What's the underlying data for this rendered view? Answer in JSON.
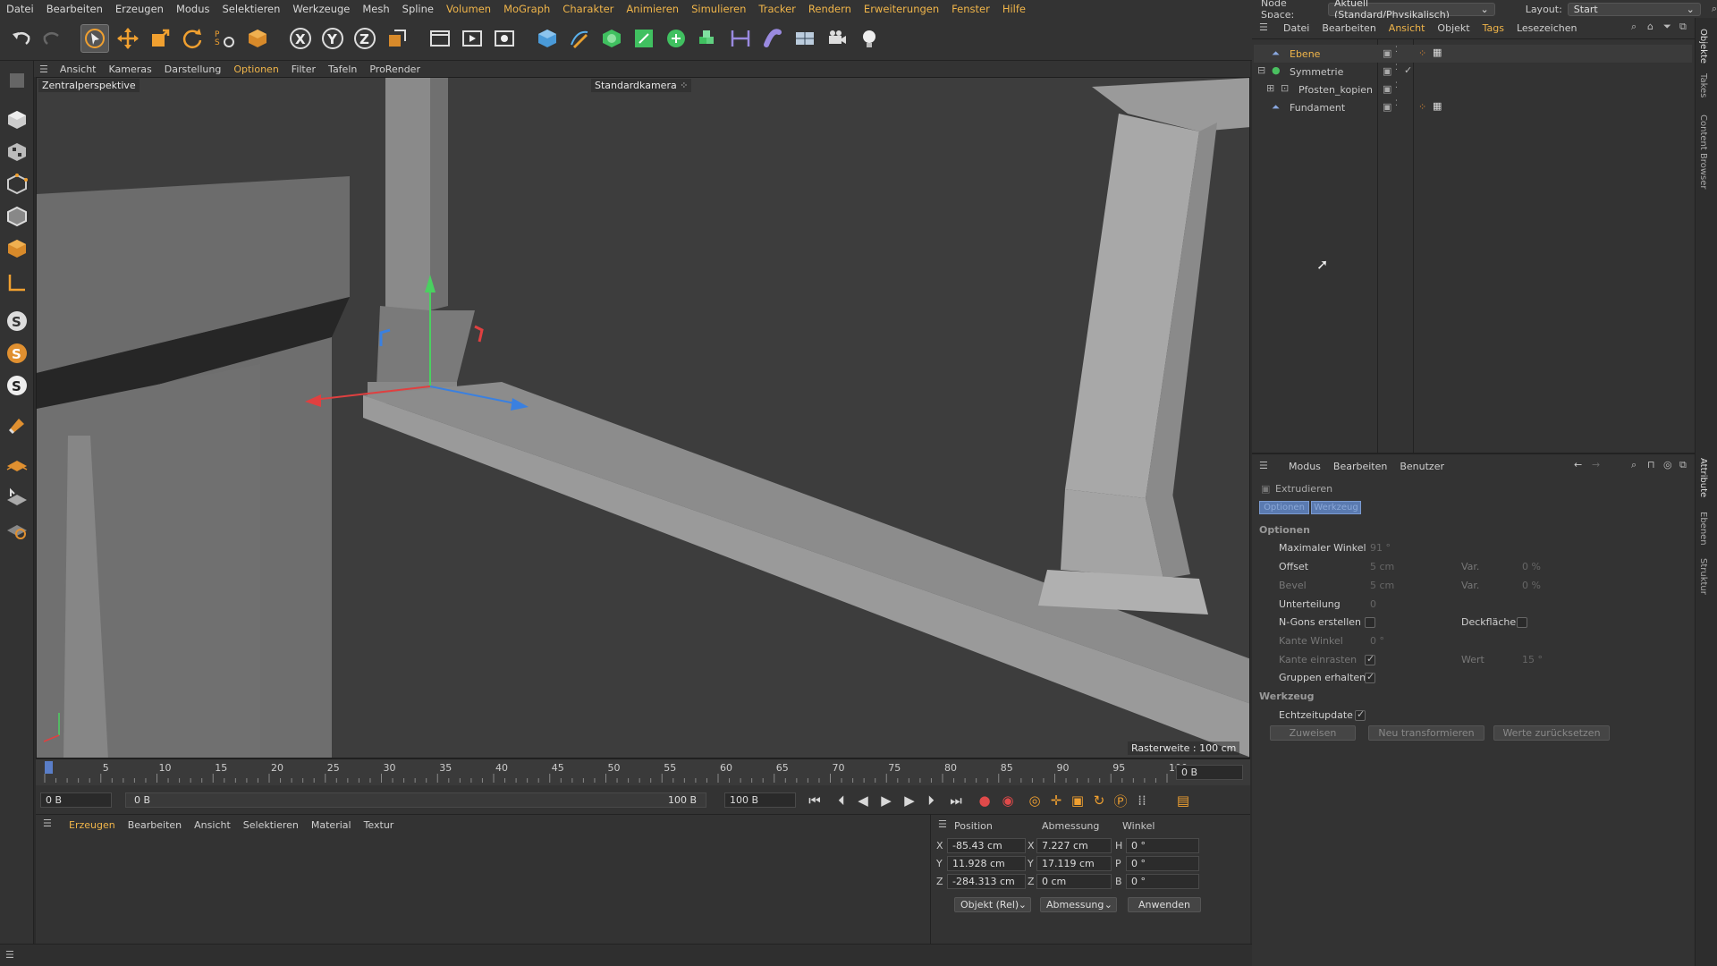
{
  "menu": [
    "Datei",
    "Bearbeiten",
    "Erzeugen",
    "Modus",
    "Selektieren",
    "Werkzeuge",
    "Mesh",
    "Spline",
    "Volumen",
    "MoGraph",
    "Charakter",
    "Animieren",
    "Simulieren",
    "Tracker",
    "Rendern",
    "Erweiterungen",
    "Fenster",
    "Hilfe"
  ],
  "node_space": {
    "label": "Node Space:",
    "value": "Aktuell (Standard/Physikalisch)"
  },
  "layout": {
    "label": "Layout:",
    "value": "Start"
  },
  "viewport": {
    "menu": [
      "Ansicht",
      "Kameras",
      "Darstellung",
      "Optionen",
      "Filter",
      "Tafeln",
      "ProRender"
    ],
    "view_name": "Zentralperspektive",
    "camera": "Standardkamera",
    "grid_info": "Rasterweite : 100 cm"
  },
  "timeline": {
    "ticks": [
      "0",
      "5",
      "10",
      "15",
      "20",
      "25",
      "30",
      "35",
      "40",
      "45",
      "50",
      "55",
      "60",
      "65",
      "70",
      "75",
      "80",
      "85",
      "90",
      "95",
      "100"
    ],
    "current_frame": "0 B"
  },
  "transport": {
    "start": "0 B",
    "range_start": "0 B",
    "range_end": "100 B",
    "end": "100 B"
  },
  "material_menu": [
    "Erzeugen",
    "Bearbeiten",
    "Ansicht",
    "Selektieren",
    "Material",
    "Textur"
  ],
  "coords": {
    "headers": {
      "position": "Position",
      "size": "Abmessung",
      "rotation": "Winkel"
    },
    "pos": {
      "x": "-85.43 cm",
      "y": "11.928 cm",
      "z": "-284.313 cm"
    },
    "size": {
      "x": "7.227 cm",
      "y": "17.119 cm",
      "z": "0 cm"
    },
    "rot": {
      "h": "0 °",
      "p": "0 °",
      "b": "0 °"
    },
    "mode": "Objekt (Rel)",
    "size_mode": "Abmessung",
    "apply": "Anwenden"
  },
  "objects_menu": [
    "Datei",
    "Bearbeiten",
    "Ansicht",
    "Objekt",
    "Tags",
    "Lesezeichen"
  ],
  "objects": [
    {
      "name": "Ebene",
      "selected": true
    },
    {
      "name": "Symmetrie"
    },
    {
      "name": "Pfosten_kopien"
    },
    {
      "name": "Fundament"
    }
  ],
  "attributes": {
    "menu": [
      "Modus",
      "Bearbeiten",
      "Benutzer"
    ],
    "tool_name": "Extrudieren",
    "tabs": [
      "Optionen",
      "Werkzeug"
    ],
    "section_options": "Optionen",
    "max_angle": {
      "label": "Maximaler Winkel",
      "value": "91 °"
    },
    "offset": {
      "label": "Offset",
      "value": "5 cm"
    },
    "offset_var": {
      "label": "Var.",
      "value": "0 %"
    },
    "bevel": {
      "label": "Bevel",
      "value": "5 cm"
    },
    "bevel_var": {
      "label": "Var.",
      "value": "0 %"
    },
    "subdivision": {
      "label": "Unterteilung",
      "value": "0"
    },
    "ngons": {
      "label": "N-Gons erstellen"
    },
    "cap": {
      "label": "Deckfläche"
    },
    "edge_angle": {
      "label": "Kante Winkel",
      "value": "0 °"
    },
    "edge_snap": {
      "label": "Kante einrasten"
    },
    "snap_value": {
      "label": "Wert",
      "value": "15 °"
    },
    "keep_groups": {
      "label": "Gruppen erhalten"
    },
    "section_tool": "Werkzeug",
    "realtime": {
      "label": "Echtzeitupdate"
    },
    "buttons": [
      "Zuweisen",
      "Neu transformieren",
      "Werte zurücksetzen"
    ]
  },
  "side_tabs": [
    "Objekte",
    "Takes",
    "Content Browser",
    "Attribute",
    "Ebenen",
    "Struktur"
  ]
}
